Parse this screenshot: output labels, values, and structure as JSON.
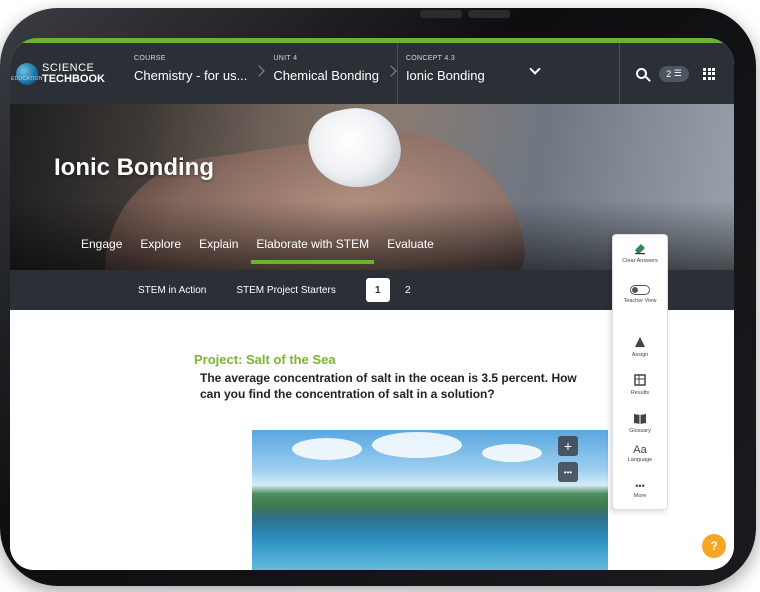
{
  "brand": {
    "line1": "SCIENCE",
    "line2": "TECHBOOK",
    "sub": "EDUCATION"
  },
  "breadcrumb": {
    "course": {
      "label": "COURSE",
      "value": "Chemistry - for us..."
    },
    "unit": {
      "label": "UNIT 4",
      "value": "Chemical Bonding"
    },
    "concept": {
      "label": "CONCEPT 4.3",
      "value": "Ionic Bonding"
    }
  },
  "header": {
    "badge_count": "2"
  },
  "hero": {
    "title": "Ionic Bonding"
  },
  "tabs": [
    {
      "label": "Engage"
    },
    {
      "label": "Explore"
    },
    {
      "label": "Explain"
    },
    {
      "label": "Elaborate with STEM",
      "active": true
    },
    {
      "label": "Evaluate"
    }
  ],
  "subnav": {
    "items": [
      {
        "label": "STEM in Action"
      },
      {
        "label": "STEM Project Starters"
      }
    ],
    "pages": [
      {
        "label": "1",
        "active": true
      },
      {
        "label": "2"
      }
    ]
  },
  "content": {
    "project_title": "Project: Salt of the Sea",
    "question": "The average concentration of salt in the ocean is 3.5 percent. How can you find the concentration of salt in a solution?",
    "photo_controls": {
      "expand": "+",
      "more": "•••"
    }
  },
  "tools": [
    {
      "label": "Clear Answers",
      "icon": "eraser-icon"
    },
    {
      "label": "Teacher View",
      "icon": "toggle-icon"
    },
    {
      "label": "Assign",
      "icon": "assign-icon"
    },
    {
      "label": "Results",
      "icon": "results-icon"
    },
    {
      "label": "Glossary",
      "icon": "book-icon"
    },
    {
      "label": "Language",
      "icon": "language-icon",
      "glyph": "Aa"
    },
    {
      "label": "More",
      "icon": "more-icon",
      "glyph": "•••"
    }
  ],
  "help": {
    "glyph": "?"
  },
  "colors": {
    "accent": "#69b32f",
    "nav": "#2b2f36",
    "project_title": "#7cb534",
    "help": "#f5a623"
  }
}
